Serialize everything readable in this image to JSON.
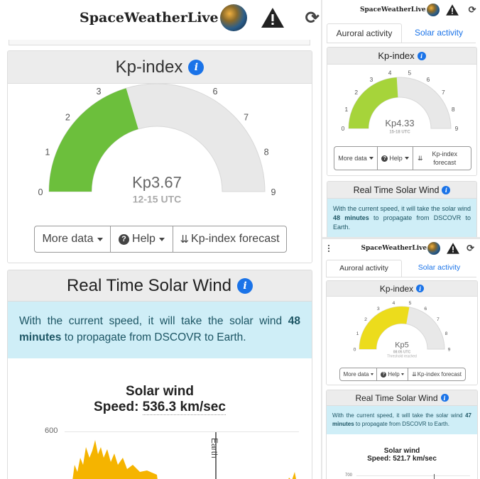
{
  "app": {
    "name": "SpaceWeatherLive"
  },
  "tabs": {
    "auroral": "Auroral activity",
    "solar": "Solar activity"
  },
  "kp_card": {
    "title": "Kp-index",
    "more_data": "More data",
    "help": "Help",
    "forecast": "Kp-index forecast"
  },
  "gauge_ticks": [
    "0",
    "1",
    "2",
    "3",
    "4",
    "5",
    "6",
    "7",
    "8",
    "9"
  ],
  "gauges": [
    {
      "value": 3.67,
      "label": "Kp3.67",
      "time": "12-15 UTC",
      "color": "#6cbf3c"
    },
    {
      "value": 4.33,
      "label": "Kp4.33",
      "time": "15-18 UTC",
      "color": "#a6d43a"
    },
    {
      "value": 5,
      "label": "Kp5",
      "time": "08:05 UTC",
      "note": "Threshold reached",
      "color": "#ecdc1c"
    }
  ],
  "solar_card": {
    "title": "Real Time Solar Wind",
    "chart_title": "Solar wind",
    "speed_prefix": "Speed: ",
    "earth_label": "Earth"
  },
  "solar_wind": [
    {
      "pre": "With the current speed, it will take the solar wind ",
      "minutes": "48 minutes",
      "post": " to propagate from DSCOVR to Earth.",
      "speed": "536.3 km/sec",
      "axis_top": "600"
    },
    {
      "pre": "With the current speed, it will take the solar wind ",
      "minutes": "48 minutes",
      "post": " to propagate from DSCOVR to Earth."
    },
    {
      "pre": "With the current speed, it will take the solar wind ",
      "minutes": "47 minutes",
      "post": " to propagate from DSCOVR to Earth.",
      "speed": "521.7 km/sec",
      "axis_top": "700"
    }
  ],
  "colors": {
    "accent": "#1a73e8",
    "notice_bg": "#cfeef7",
    "track": "#e8e8e8",
    "chart_fill": "#f5b400"
  },
  "icons": [
    "hamburger-icon",
    "warning-icon",
    "refresh-icon",
    "info-icon",
    "help-icon",
    "double-chevron-down-icon"
  ]
}
